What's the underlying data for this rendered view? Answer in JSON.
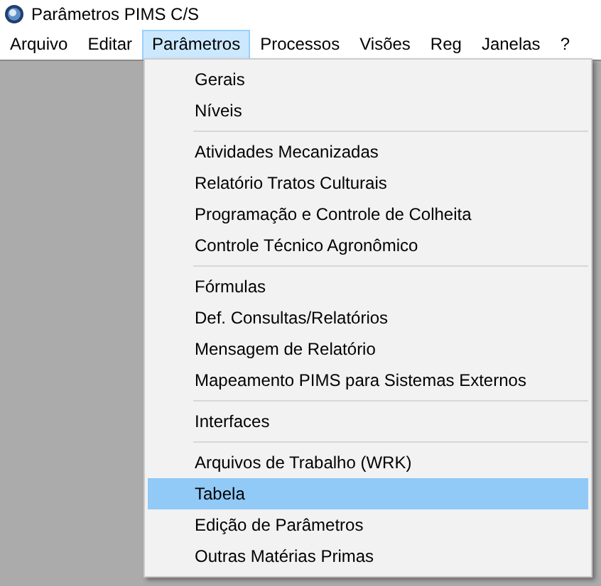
{
  "window": {
    "title": "Parâmetros PIMS C/S"
  },
  "menu_bar": [
    {
      "label": "Arquivo",
      "selected": false
    },
    {
      "label": "Editar",
      "selected": false
    },
    {
      "label": "Parâmetros",
      "selected": true
    },
    {
      "label": "Processos",
      "selected": false
    },
    {
      "label": "Visões",
      "selected": false
    },
    {
      "label": "Reg",
      "selected": false
    },
    {
      "label": "Janelas",
      "selected": false
    },
    {
      "label": "?",
      "selected": false
    }
  ],
  "dropdown_menu": {
    "groups": [
      [
        {
          "label": "Gerais",
          "selected": false
        },
        {
          "label": "Níveis",
          "selected": false
        }
      ],
      [
        {
          "label": "Atividades Mecanizadas",
          "selected": false
        },
        {
          "label": "Relatório Tratos Culturais",
          "selected": false
        },
        {
          "label": "Programação e Controle de Colheita",
          "selected": false
        },
        {
          "label": "Controle Técnico Agronômico",
          "selected": false
        }
      ],
      [
        {
          "label": "Fórmulas",
          "selected": false
        },
        {
          "label": "Def. Consultas/Relatórios",
          "selected": false
        },
        {
          "label": "Mensagem de Relatório",
          "selected": false
        },
        {
          "label": "Mapeamento PIMS para Sistemas Externos",
          "selected": false
        }
      ],
      [
        {
          "label": "Interfaces",
          "selected": false
        }
      ],
      [
        {
          "label": "Arquivos de Trabalho (WRK)",
          "selected": false
        },
        {
          "label": "Tabela",
          "selected": true
        },
        {
          "label": "Edição de Parâmetros",
          "selected": false
        },
        {
          "label": "Outras Matérias Primas",
          "selected": false
        }
      ]
    ]
  }
}
